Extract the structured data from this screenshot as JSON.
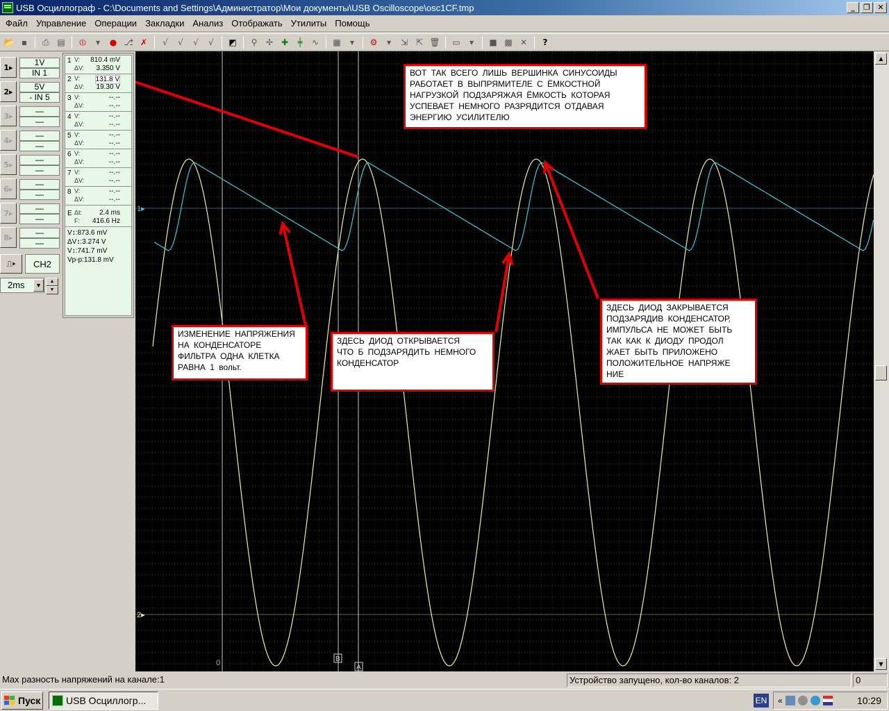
{
  "window": {
    "title": "USB Осциллограф - C:\\Documents and Settings\\Администратор\\Мои документы\\USB Oscilloscope\\osc1CF.tmp",
    "btn_min": "_",
    "btn_max": "❐",
    "btn_close": "✕"
  },
  "menu": [
    "Файл",
    "Управление",
    "Операции",
    "Закладки",
    "Анализ",
    "Отображать",
    "Утилиты",
    "Помощь"
  ],
  "channels": [
    {
      "btn": "1▸",
      "top": "1V",
      "bottom": "IN 1",
      "enabled": true
    },
    {
      "btn": "2▸",
      "top": "5V",
      "bottom": "- IN 5",
      "enabled": true
    },
    {
      "btn": "3▸",
      "top": "—",
      "bottom": "—",
      "enabled": false
    },
    {
      "btn": "4▸",
      "top": "—",
      "bottom": "—",
      "enabled": false
    },
    {
      "btn": "5▸",
      "top": "—",
      "bottom": "—",
      "enabled": false
    },
    {
      "btn": "6▸",
      "top": "—",
      "bottom": "—",
      "enabled": false
    },
    {
      "btn": "7▸",
      "top": "—",
      "bottom": "—",
      "enabled": false
    },
    {
      "btn": "8▸",
      "top": "—",
      "bottom": "—",
      "enabled": false
    }
  ],
  "trigger": {
    "button": "⎍▸",
    "channel": "CH2"
  },
  "timebase": {
    "value": "2ms",
    "drop": "▼",
    "up": "▲",
    "down": "▼"
  },
  "measurements": {
    "rows": [
      {
        "num": "1",
        "l1": "V:",
        "l2": "ΔV:",
        "v1": "810.4 mV",
        "v2": "3.350 V"
      },
      {
        "num": "2",
        "l1": "V:",
        "l2": "ΔV:",
        "v1": "131.8 V",
        "v2": "19.30 V"
      },
      {
        "num": "3",
        "l1": "V:",
        "l2": "ΔV:",
        "v1": "--.--",
        "v2": "--.--"
      },
      {
        "num": "4",
        "l1": "V:",
        "l2": "ΔV:",
        "v1": "--.--",
        "v2": "--.--"
      },
      {
        "num": "5",
        "l1": "V:",
        "l2": "ΔV:",
        "v1": "--.--",
        "v2": "--.--"
      },
      {
        "num": "6",
        "l1": "V:",
        "l2": "ΔV:",
        "v1": "--.--",
        "v2": "--.--"
      },
      {
        "num": "7",
        "l1": "V:",
        "l2": "ΔV:",
        "v1": "--.--",
        "v2": "--.--"
      },
      {
        "num": "8",
        "l1": "V:",
        "l2": "ΔV:",
        "v1": "--.--",
        "v2": "--.--"
      }
    ],
    "time": {
      "num": "E",
      "l1": "Δt:",
      "l2": "F:",
      "v1": "2.4 ms",
      "v2": "416.6 Hz"
    },
    "extra": [
      "V↕:873.6 mV",
      "ΔV↕:3.274 V",
      "V↕:741.7 mV",
      "Vp-p:131.8 mV"
    ]
  },
  "scope": {
    "marker_ch1": "1▸",
    "marker_ch2": "2▸",
    "marker_zero": "0",
    "cursor_a": "A",
    "cursor_b": "B",
    "colors": {
      "ch1": "#40c8d8",
      "ch2": "#f0f0a0",
      "grid": "#3a3a3a",
      "annotation": "#e00000"
    }
  },
  "annotations": {
    "top": "ВОТ  ТАК  ВСЕГО  ЛИШЬ  ВЕРШИНКА  СИНУСОИДЫ\nРАБОТАЕТ  В  ВЫПРЯМИТЕЛЕ  С  ЁМКОСТНОЙ\nНАГРУЗКОЙ  ПОДЗАРЯЖАЯ  ЁМКОСТЬ  КОТОРАЯ\nУСПЕВАЕТ  НЕМНОГО  РАЗРЯДИТСЯ  ОТДАВАЯ\nЭНЕРГИЮ  УСИЛИТЕЛЮ",
    "left": " ИЗМЕНЕНИЕ  НАПРЯЖЕНИЯ\nНА  КОНДЕНСАТОРЕ\nФИЛЬТРА  ОДНА  КЛЕТКА\nРАВНА  1 вольт.",
    "middle": "ЗДЕСЬ  ДИОД  ОТКРЫВАЕТСЯ\nЧТО Б ПОДЗАРЯДИТЬ  НЕМНОГО\n КОНДЕНСАТОР",
    "right": "ЗДЕСЬ  ДИОД  ЗАКРЫВАЕТСЯ\n ПОДЗАРЯДИВ  КОНДЕНСАТОР,\nИМПУЛЬСА  НЕ  МОЖЕТ  БЫТЬ\nТАК  КАК  К  ДИОДУ  ПРОДОЛ\nЖАЕТ  БЫТЬ  ПРИЛОЖЕНО\nПОЛОЖИТЕЛЬНОЕ  НАПРЯЖЕ\nНИЕ"
  },
  "status": {
    "left": "Max разность напряжений на канале:1",
    "middle": "Устройство запущено, кол-во каналов: 2",
    "right": "0"
  },
  "taskbar": {
    "start": "Пуск",
    "task": "USB Осциллогр...",
    "lang": "EN",
    "tray_expand": "«",
    "clock": "10:29"
  },
  "scrollbar": {
    "up": "▲",
    "down": "▼"
  }
}
